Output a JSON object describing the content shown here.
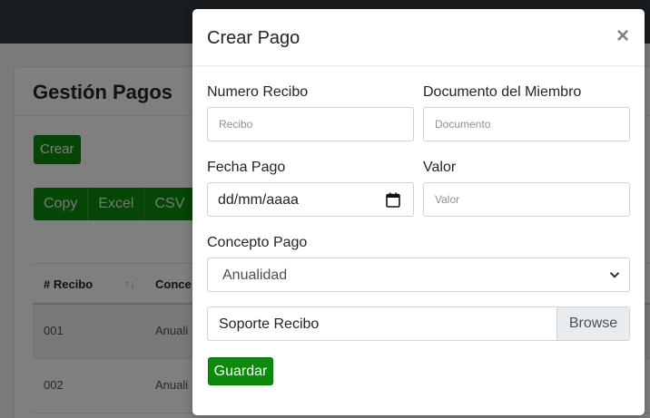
{
  "background": {
    "page_title": "Gestión Pagos",
    "create_button": "Crear",
    "export_buttons": [
      "Copy",
      "Excel",
      "CSV"
    ],
    "table": {
      "columns": [
        "# Recibo",
        "Conce"
      ],
      "sort_indicator": "↑↓",
      "rows": [
        {
          "recibo": "001",
          "concepto": "Anuali"
        },
        {
          "recibo": "002",
          "concepto": "Anuali"
        }
      ]
    }
  },
  "modal": {
    "title": "Crear Pago",
    "close_glyph": "×",
    "fields": {
      "numero_recibo": {
        "label": "Numero Recibo",
        "placeholder": "Recibo",
        "value": ""
      },
      "documento_miembro": {
        "label": "Documento del Miembro",
        "placeholder": "Documento",
        "value": ""
      },
      "fecha_pago": {
        "label": "Fecha Pago",
        "display": "dd/mm/aaaa"
      },
      "valor": {
        "label": "Valor",
        "placeholder": "Valor",
        "value": ""
      },
      "concepto_pago": {
        "label": "Concepto Pago",
        "selected": "Anualidad"
      },
      "soporte_recibo": {
        "label": "Soporte Recibo",
        "browse_label": "Browse"
      }
    },
    "save_button": "Guardar"
  },
  "colors": {
    "accent_green": "#0b8a0b",
    "topbar": "#343a40",
    "overlay": "rgba(0,0,0,0.5)"
  },
  "icons": [
    "close-icon",
    "calendar-icon",
    "chevron-down-icon",
    "sort-icon"
  ]
}
